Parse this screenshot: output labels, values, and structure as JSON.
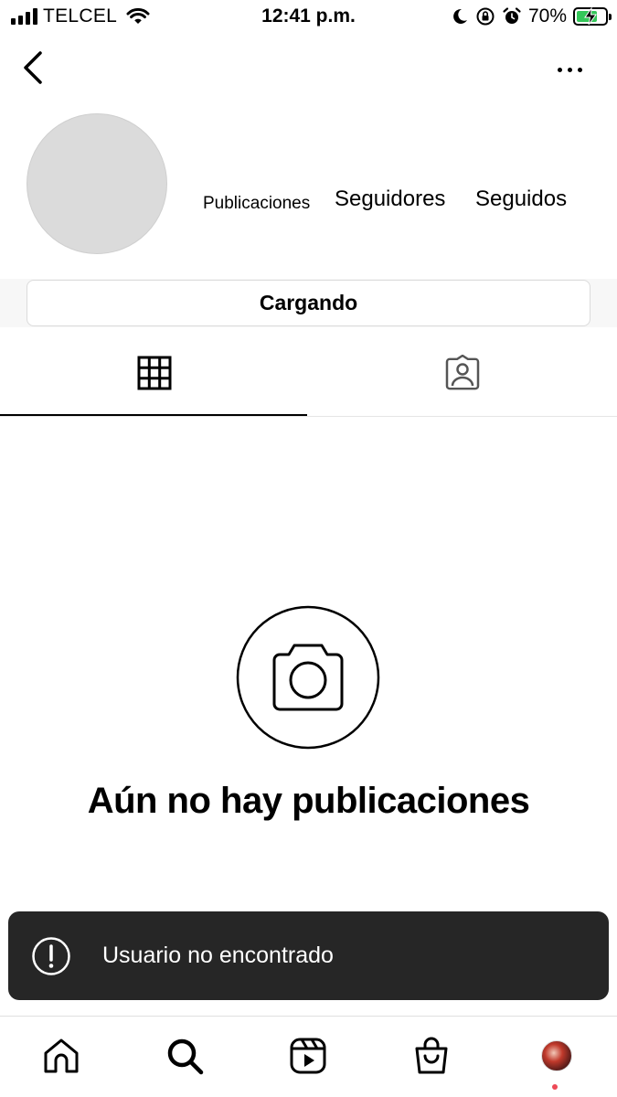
{
  "status_bar": {
    "carrier": "TELCEL",
    "time": "12:41 p.m.",
    "battery_percent": "70%",
    "battery_level": 0.7,
    "icons": [
      "signal-icon",
      "wifi-icon",
      "moon-icon",
      "orientation-lock-icon",
      "alarm-icon",
      "battery-charging-icon"
    ]
  },
  "header": {
    "back_icon": "chevron-left-icon",
    "more_icon": "more-horizontal-icon"
  },
  "profile": {
    "stats": {
      "posts_label": "Publicaciones",
      "followers_label": "Seguidores",
      "following_label": "Seguidos"
    },
    "loading_button_label": "Cargando"
  },
  "tabs": [
    {
      "name": "grid",
      "icon": "grid-icon",
      "active": true
    },
    {
      "name": "tagged",
      "icon": "tagged-user-icon",
      "active": false
    }
  ],
  "empty_state": {
    "icon": "camera-icon",
    "title": "Aún no hay publicaciones"
  },
  "toast": {
    "icon": "alert-circle-icon",
    "message": "Usuario no encontrado",
    "background": "#262626"
  },
  "bottom_nav": {
    "items": [
      "home-icon",
      "search-icon",
      "reels-icon",
      "shop-icon",
      "profile-avatar"
    ],
    "notification_dot_color": "#ed4956"
  },
  "colors": {
    "battery_fill": "#34c759",
    "avatar_placeholder": "#dbdbdb"
  }
}
